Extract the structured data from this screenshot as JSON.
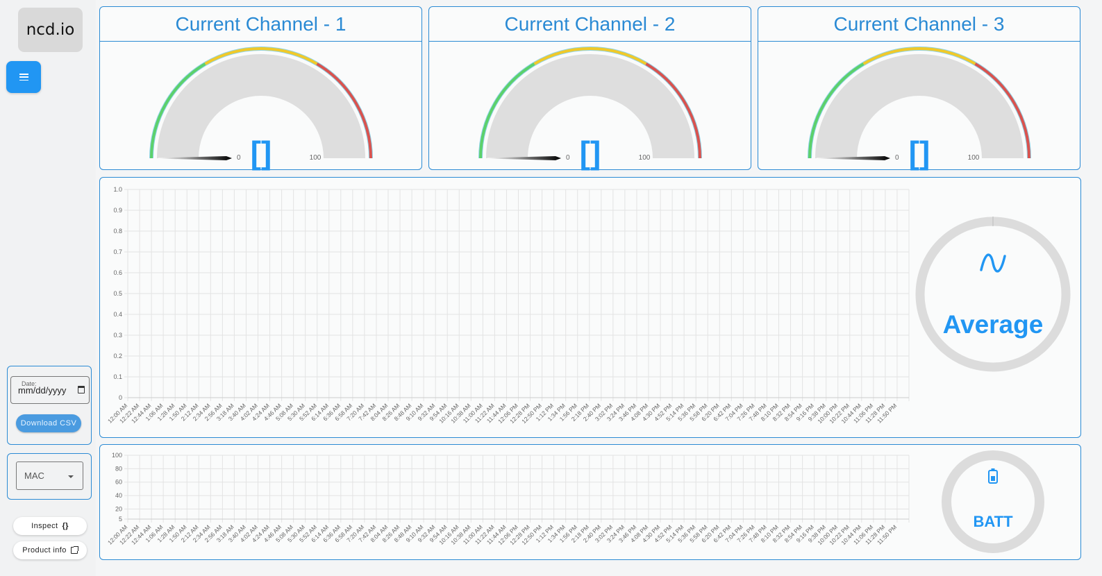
{
  "sidebar": {
    "logo": "ncd.io",
    "menu_icon": "hamburger-menu-icon",
    "date": {
      "label": "Date:",
      "placeholder": "mm/dd/yyyy",
      "icon": "calendar-icon"
    },
    "download_label": "Download CSV",
    "mac_select": {
      "value": "MAC",
      "icon": "caret-down-icon"
    },
    "inspect_label": "Inspect",
    "inspect_icon": "{}",
    "product_label": "Product info",
    "product_icon": "external-link-icon"
  },
  "gauges": [
    {
      "title": "Current Channel - 1",
      "min": "0",
      "max": "100",
      "value": 0,
      "value_text": "[]"
    },
    {
      "title": "Current Channel - 2",
      "min": "0",
      "max": "100",
      "value": 0,
      "value_text": "[]"
    },
    {
      "title": "Current Channel - 3",
      "min": "0",
      "max": "100",
      "value": 0,
      "value_text": "[]"
    }
  ],
  "gauge_sectors": {
    "colors": [
      "#5cd16b",
      "#f0c92a",
      "#d9534f"
    ],
    "breaks": [
      0.33,
      0.67
    ]
  },
  "average_widget": {
    "label": "Average",
    "icon": "sine-wave-icon",
    "value": 0
  },
  "batt_widget": {
    "label": "BATT",
    "icon": "battery-icon",
    "value": 0
  },
  "colors": {
    "accent": "#2a8ad4",
    "primary": "#2196f3"
  },
  "chart_data": [
    {
      "type": "line",
      "title": "",
      "xlabel": "",
      "ylabel": "",
      "ylim": [
        0,
        1.0
      ],
      "yticks": [
        "0",
        "0.1",
        "0.2",
        "0.3",
        "0.4",
        "0.5",
        "0.6",
        "0.7",
        "0.8",
        "0.9",
        "1.0"
      ],
      "grid": true,
      "x": [
        "12:00 AM",
        "12:22 AM",
        "12:44 AM",
        "1:06 AM",
        "1:28 AM",
        "1:50 AM",
        "2:12 AM",
        "2:34 AM",
        "2:56 AM",
        "3:18 AM",
        "3:40 AM",
        "4:02 AM",
        "4:24 AM",
        "4:46 AM",
        "5:08 AM",
        "5:30 AM",
        "5:52 AM",
        "6:14 AM",
        "6:36 AM",
        "6:58 AM",
        "7:20 AM",
        "7:42 AM",
        "8:04 AM",
        "8:26 AM",
        "8:48 AM",
        "9:10 AM",
        "9:32 AM",
        "9:54 AM",
        "10:16 AM",
        "10:38 AM",
        "11:00 AM",
        "11:22 AM",
        "11:44 AM",
        "12:06 PM",
        "12:28 PM",
        "12:50 PM",
        "1:12 PM",
        "1:34 PM",
        "1:56 PM",
        "2:18 PM",
        "2:40 PM",
        "3:02 PM",
        "3:24 PM",
        "3:46 PM",
        "4:08 PM",
        "4:30 PM",
        "4:52 PM",
        "5:14 PM",
        "5:36 PM",
        "5:58 PM",
        "6:20 PM",
        "6:42 PM",
        "7:04 PM",
        "7:26 PM",
        "7:48 PM",
        "8:10 PM",
        "8:32 PM",
        "8:54 PM",
        "9:16 PM",
        "9:38 PM",
        "10:00 PM",
        "10:22 PM",
        "10:44 PM",
        "11:06 PM",
        "11:28 PM",
        "11:50 PM"
      ],
      "series": []
    },
    {
      "type": "line",
      "title": "",
      "xlabel": "",
      "ylabel": "",
      "ylim": [
        5,
        100
      ],
      "yticks": [
        "5",
        "20",
        "40",
        "60",
        "80",
        "100"
      ],
      "ytick_values": [
        5,
        20,
        40,
        60,
        80,
        100
      ],
      "grid": true,
      "x": "same-as-chart-1",
      "series": []
    }
  ]
}
